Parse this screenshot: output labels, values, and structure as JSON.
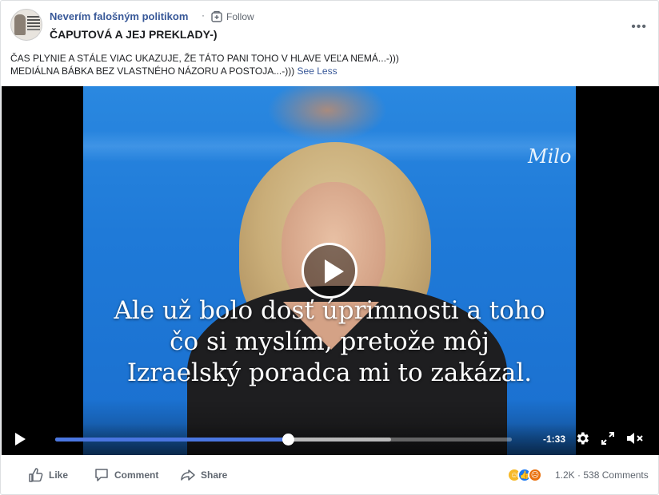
{
  "post": {
    "page_name": "Neverím falošným politikom",
    "separator": "·",
    "follow_label": "Follow",
    "title": "ČAPUTOVÁ A JEJ PREKLADY-)",
    "more_label": "•••",
    "text_lines": [
      "ČAS PLYNIE A STÁLE VIAC UKAZUJE, ŽE TÁTO PANI TOHO V HLAVE VEĽA NEMÁ...-)))",
      "MEDIÁLNA BÁBKA BEZ VLASTNÉHO NÁZORU A POSTOJA...-)))"
    ],
    "see_less_label": "See Less"
  },
  "video": {
    "watermark": "Milo",
    "subtitle_lines": [
      "Ale už bolo dosť úprimnosti a toho",
      "čo si myslím, pretože môj",
      "Izraelský poradca mi to zakázal."
    ],
    "time_remaining": "-1:33",
    "progress_played_fraction": 0.51,
    "progress_buffered_fraction": 0.735,
    "progress_color": "#4a76e0"
  },
  "actions": {
    "like_label": "Like",
    "comment_label": "Comment",
    "share_label": "Share"
  },
  "stats": {
    "reactions": [
      "haha",
      "like",
      "angry"
    ],
    "reaction_count": "1.2K",
    "separator": "·",
    "comments": "538 Comments"
  },
  "icons": {
    "follow": "follow-icon",
    "more": "more-icon",
    "play": "play-icon",
    "settings": "gear-icon",
    "fullscreen": "fullscreen-icon",
    "mute": "muted-speaker-icon",
    "like": "thumbs-up-icon",
    "comment": "comment-icon",
    "share": "share-icon"
  },
  "colors": {
    "link": "#385898",
    "muted": "#606770",
    "brand_blue": "#1877f2"
  }
}
